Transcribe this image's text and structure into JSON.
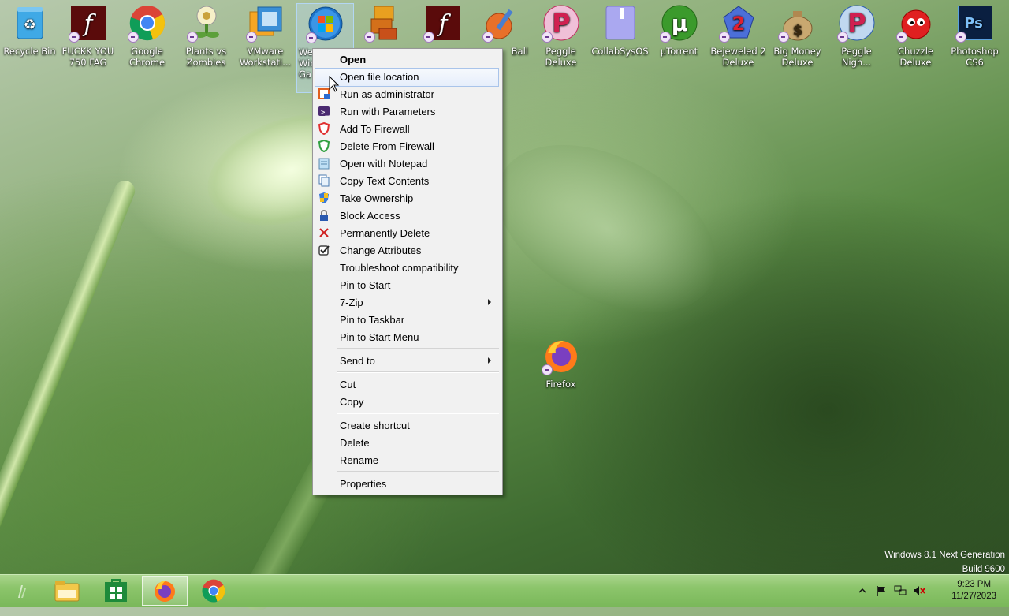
{
  "desktop": {
    "icons": [
      {
        "label": "Recycle Bin"
      },
      {
        "label": "FUCKK YOU 750 FAG"
      },
      {
        "label": "Google Chrome"
      },
      {
        "label": "Plants vs Zombies"
      },
      {
        "label": "VMware Workstati..."
      },
      {
        "label": "We Wir Ga"
      },
      {
        "label": ""
      },
      {
        "label": ""
      },
      {
        "label": "Ball"
      },
      {
        "label": "Peggle Deluxe"
      },
      {
        "label": "CollabSysOS"
      },
      {
        "label": "µTorrent"
      },
      {
        "label": "Bejeweled 2 Deluxe"
      },
      {
        "label": "Big Money Deluxe"
      },
      {
        "label": "Peggle Nigh..."
      },
      {
        "label": "Chuzzle Deluxe"
      },
      {
        "label": "Photoshop CS6"
      }
    ],
    "firefox_label": "Firefox",
    "selected_label_parts": [
      "We",
      "Wir",
      "Ga"
    ]
  },
  "context_menu": {
    "items": [
      {
        "label": "Open",
        "icon": ""
      },
      {
        "label": "Open file location",
        "icon": ""
      },
      {
        "label": "Run as administrator",
        "icon": "admin-shield-icon"
      },
      {
        "label": "Run with Parameters",
        "icon": "console-icon"
      },
      {
        "label": "Add To Firewall",
        "icon": "shield-red-icon"
      },
      {
        "label": "Delete From Firewall",
        "icon": "shield-green-icon"
      },
      {
        "label": "Open with Notepad",
        "icon": "notepad-icon"
      },
      {
        "label": "Copy Text Contents",
        "icon": "copy-text-icon"
      },
      {
        "label": "Take Ownership",
        "icon": "uac-shield-icon"
      },
      {
        "label": "Block Access",
        "icon": "lock-icon"
      },
      {
        "label": "Permanently Delete",
        "icon": "red-x-icon"
      },
      {
        "label": "Change Attributes",
        "icon": "checkbox-icon"
      },
      {
        "label": "Troubleshoot compatibility",
        "icon": ""
      },
      {
        "label": "Pin to Start",
        "icon": ""
      },
      {
        "label": "7-Zip",
        "icon": ""
      },
      {
        "label": "Pin to Taskbar",
        "icon": ""
      },
      {
        "label": "Pin to Start Menu",
        "icon": ""
      },
      {
        "label": "Send to",
        "icon": ""
      },
      {
        "label": "Cut",
        "icon": ""
      },
      {
        "label": "Copy",
        "icon": ""
      },
      {
        "label": "Create shortcut",
        "icon": ""
      },
      {
        "label": "Delete",
        "icon": ""
      },
      {
        "label": "Rename",
        "icon": ""
      },
      {
        "label": "Properties",
        "icon": ""
      }
    ]
  },
  "watermark": {
    "line1": "Windows 8.1 Next Generation",
    "line2": "Build 9600"
  },
  "taskbar": {
    "time": "9:23 PM",
    "date": "11/27/2023"
  },
  "colors": {
    "taskbar": "#8cc56b",
    "menu_bg": "#f1f1f1",
    "menu_hover_border": "#a9c4ea"
  }
}
